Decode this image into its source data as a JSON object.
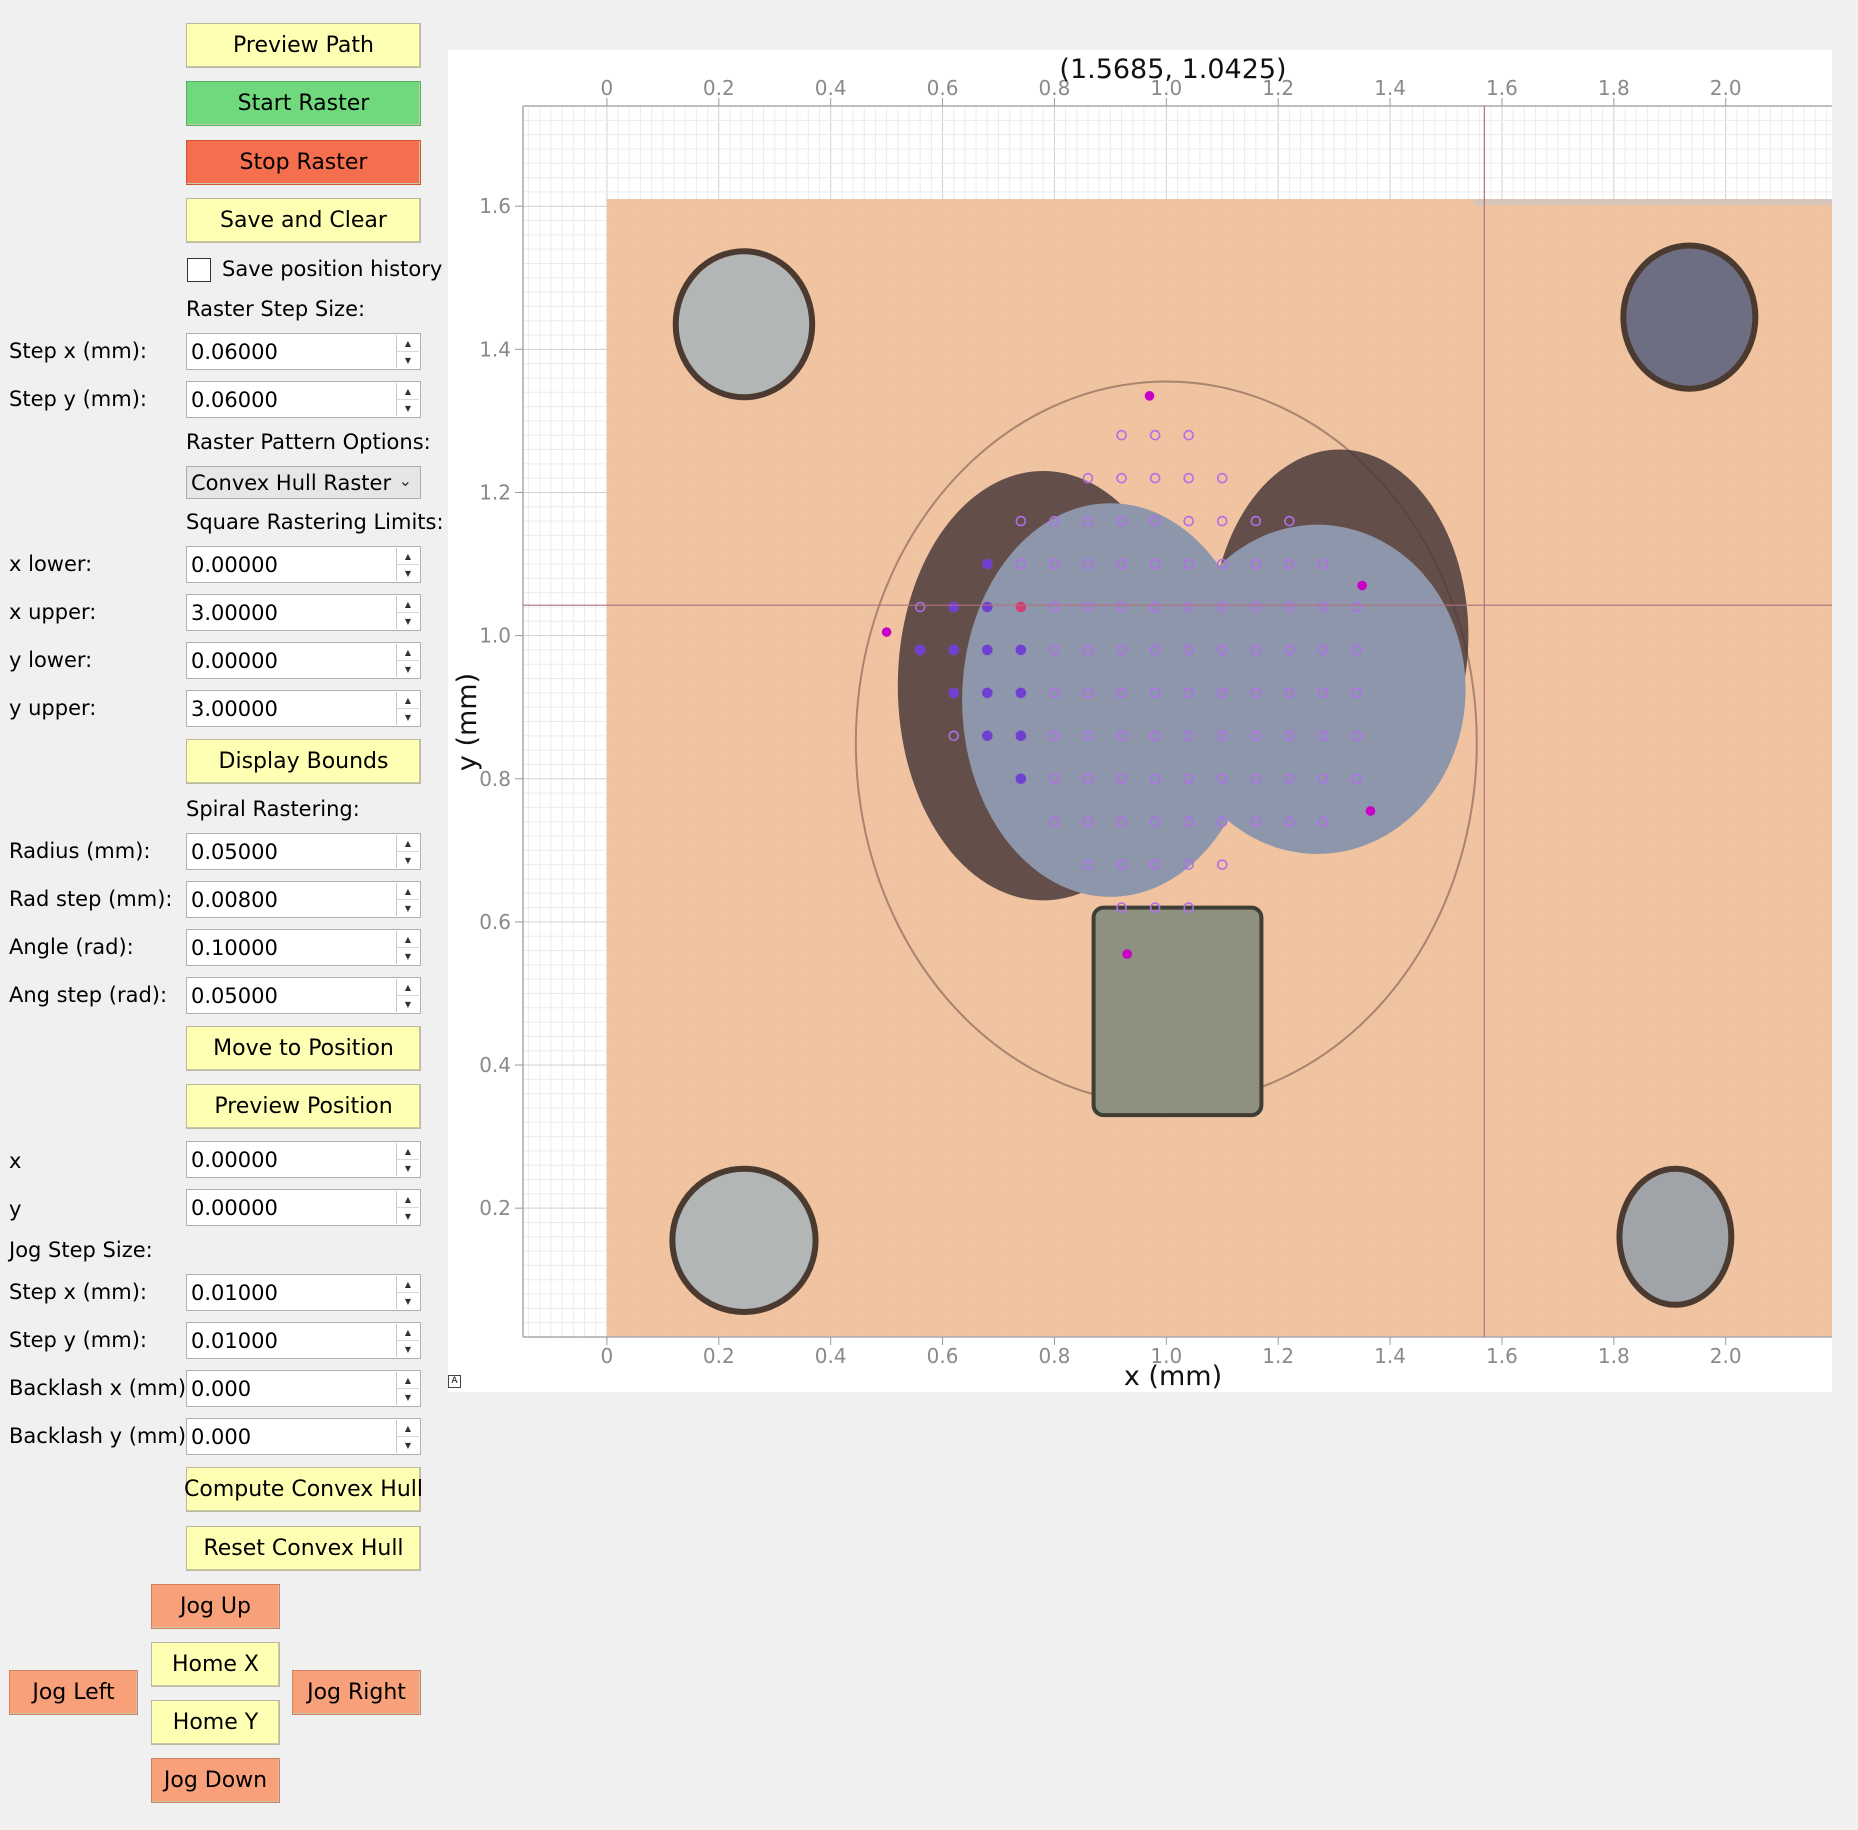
{
  "buttons": {
    "preview_path": "Preview Path",
    "start_raster": "Start Raster",
    "stop_raster": "Stop Raster",
    "save_clear": "Save and Clear",
    "display_bounds": "Display Bounds",
    "move_to_position": "Move to Position",
    "preview_position": "Preview Position",
    "compute_hull": "Compute Convex Hull",
    "reset_hull": "Reset Convex Hull",
    "jog_up": "Jog Up",
    "home_x": "Home X",
    "home_y": "Home Y",
    "jog_down": "Jog Down",
    "jog_left": "Jog Left",
    "jog_right": "Jog Right"
  },
  "save_history": {
    "label": "Save position history",
    "checked": false
  },
  "raster_step": {
    "heading": "Raster Step Size:",
    "step_x_label": "Step x (mm):",
    "step_x": "0.06000",
    "step_y_label": "Step y (mm):",
    "step_y": "0.06000"
  },
  "pattern": {
    "heading": "Raster Pattern Options:",
    "selected": "Convex Hull Raster"
  },
  "square_limits": {
    "heading": "Square Rastering Limits:",
    "x_lower_label": "x lower:",
    "x_lower": "0.00000",
    "x_upper_label": "x upper:",
    "x_upper": "3.00000",
    "y_lower_label": "y lower:",
    "y_lower": "0.00000",
    "y_upper_label": "y upper:",
    "y_upper": "3.00000"
  },
  "spiral": {
    "heading": "Spiral Rastering:",
    "radius_label": "Radius (mm):",
    "radius": "0.05000",
    "rad_step_label": "Rad step (mm):",
    "rad_step": "0.00800",
    "angle_label": "Angle (rad):",
    "angle": "0.10000",
    "ang_step_label": "Ang step (rad):",
    "ang_step": "0.05000"
  },
  "position": {
    "x_label": "x",
    "x": "0.00000",
    "y_label": "y",
    "y": "0.00000"
  },
  "jog_step": {
    "heading": "Jog Step Size:",
    "step_x_label": "Step x (mm):",
    "step_x": "0.01000",
    "step_y_label": "Step y (mm):",
    "step_y": "0.01000",
    "backlash_x_label": "Backlash x (mm):",
    "backlash_x": "0.000",
    "backlash_y_label": "Backlash y (mm):",
    "backlash_y": "0.000"
  },
  "plot": {
    "cursor_readout": "(1.5685, 1.0425)",
    "corner_icon": "A",
    "cursor": {
      "x": 1.5685,
      "y": 1.0425
    },
    "colors": {
      "copper": "#efc09c",
      "hull_point": "#b070e8",
      "visited_point": "#7040d0",
      "marker_point": "#c800c8",
      "current_point": "#d04070",
      "crosshair": "#b07080"
    }
  },
  "chart_data": {
    "type": "scatter",
    "xlabel": "x (mm)",
    "ylabel": "y (mm)",
    "xlim": [
      -0.15,
      2.19
    ],
    "ylim": [
      0.02,
      1.74
    ],
    "x_ticks": [
      "0",
      "0.2",
      "0.4",
      "0.6",
      "0.8",
      "1.0",
      "1.2",
      "1.4",
      "1.6",
      "1.8",
      "2.0"
    ],
    "y_ticks": [
      "0.2",
      "0.4",
      "0.6",
      "0.8",
      "1.0",
      "1.2",
      "1.4",
      "1.6"
    ],
    "x_tick_values": [
      0,
      0.2,
      0.4,
      0.6,
      0.8,
      1.0,
      1.2,
      1.4,
      1.6,
      1.8,
      2.0
    ],
    "y_tick_values": [
      0.2,
      0.4,
      0.6,
      0.8,
      1.0,
      1.2,
      1.4,
      1.6
    ],
    "grid": true,
    "background_image_extent": {
      "x": [
        0.0,
        2.2
      ],
      "y": [
        0.02,
        1.61
      ]
    },
    "series": [
      {
        "role": "hull_boundary",
        "x": [
          0.97,
          1.35,
          1.365,
          0.93,
          0.5
        ],
        "y": [
          1.335,
          1.07,
          0.755,
          0.555,
          1.005
        ]
      },
      {
        "role": "raster_points",
        "x": [
          0.92,
          0.98,
          1.04,
          0.86,
          0.92,
          0.98,
          1.04,
          1.1,
          0.74,
          0.8,
          0.86,
          0.92,
          0.98,
          1.04,
          1.1,
          1.16,
          1.22,
          0.68,
          0.74,
          0.8,
          0.86,
          0.92,
          0.98,
          1.04,
          1.1,
          1.16,
          1.22,
          1.28,
          0.56,
          0.62,
          0.68,
          0.74,
          0.8,
          0.86,
          0.92,
          0.98,
          1.04,
          1.1,
          1.16,
          1.22,
          1.28,
          1.34,
          0.56,
          0.62,
          0.68,
          0.74,
          0.8,
          0.86,
          0.92,
          0.98,
          1.04,
          1.1,
          1.16,
          1.22,
          1.28,
          1.34,
          0.62,
          0.68,
          0.74,
          0.8,
          0.86,
          0.92,
          0.98,
          1.04,
          1.1,
          1.16,
          1.22,
          1.28,
          1.34,
          0.62,
          0.68,
          0.74,
          0.8,
          0.86,
          0.92,
          0.98,
          1.04,
          1.1,
          1.16,
          1.22,
          1.28,
          1.34,
          0.74,
          0.8,
          0.86,
          0.92,
          0.98,
          1.04,
          1.1,
          1.16,
          1.22,
          1.28,
          1.34,
          0.8,
          0.86,
          0.92,
          0.98,
          1.04,
          1.1,
          1.16,
          1.22,
          1.28,
          0.86,
          0.92,
          0.98,
          1.04,
          1.1,
          0.92,
          0.98,
          1.04
        ],
        "y": [
          1.28,
          1.28,
          1.28,
          1.22,
          1.22,
          1.22,
          1.22,
          1.22,
          1.16,
          1.16,
          1.16,
          1.16,
          1.16,
          1.16,
          1.16,
          1.16,
          1.16,
          1.1,
          1.1,
          1.1,
          1.1,
          1.1,
          1.1,
          1.1,
          1.1,
          1.1,
          1.1,
          1.1,
          1.04,
          1.04,
          1.04,
          1.04,
          1.04,
          1.04,
          1.04,
          1.04,
          1.04,
          1.04,
          1.04,
          1.04,
          1.04,
          1.04,
          0.98,
          0.98,
          0.98,
          0.98,
          0.98,
          0.98,
          0.98,
          0.98,
          0.98,
          0.98,
          0.98,
          0.98,
          0.98,
          0.98,
          0.92,
          0.92,
          0.92,
          0.92,
          0.92,
          0.92,
          0.92,
          0.92,
          0.92,
          0.92,
          0.92,
          0.92,
          0.92,
          0.86,
          0.86,
          0.86,
          0.86,
          0.86,
          0.86,
          0.86,
          0.86,
          0.86,
          0.86,
          0.86,
          0.86,
          0.86,
          0.8,
          0.8,
          0.8,
          0.8,
          0.8,
          0.8,
          0.8,
          0.8,
          0.8,
          0.8,
          0.8,
          0.74,
          0.74,
          0.74,
          0.74,
          0.74,
          0.74,
          0.74,
          0.74,
          0.74,
          0.68,
          0.68,
          0.68,
          0.68,
          0.68,
          0.62,
          0.62,
          0.62
        ]
      },
      {
        "role": "visited_points",
        "x": [
          0.68,
          0.62,
          0.68,
          0.56,
          0.62,
          0.68,
          0.74,
          0.62,
          0.68,
          0.74,
          0.68,
          0.74,
          0.74
        ],
        "y": [
          1.1,
          1.04,
          1.04,
          0.98,
          0.98,
          0.98,
          0.98,
          0.92,
          0.92,
          0.92,
          0.86,
          0.86,
          0.8
        ]
      },
      {
        "role": "current_point",
        "x": [
          0.74
        ],
        "y": [
          1.04
        ]
      }
    ]
  }
}
